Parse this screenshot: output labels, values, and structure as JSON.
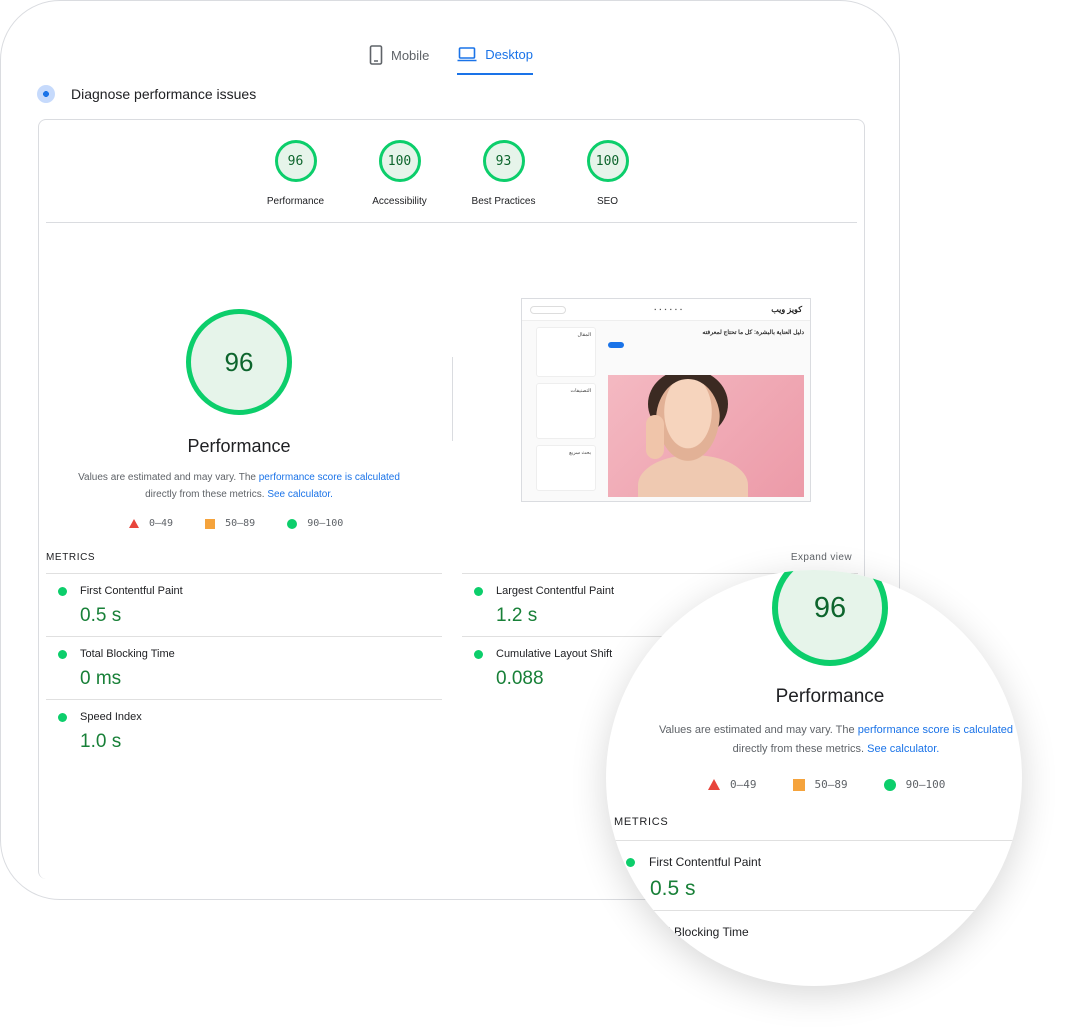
{
  "tabs": {
    "mobile": "Mobile",
    "desktop": "Desktop"
  },
  "diagnose_title": "Diagnose performance issues",
  "categories": [
    {
      "score": "96",
      "label": "Performance"
    },
    {
      "score": "100",
      "label": "Accessibility"
    },
    {
      "score": "93",
      "label": "Best Practices"
    },
    {
      "score": "100",
      "label": "SEO"
    }
  ],
  "performance": {
    "score": "96",
    "title": "Performance",
    "note_prefix": "Values are estimated and may vary. The ",
    "note_link1": "performance score is calculated",
    "note_middle": "directly from these metrics. ",
    "note_link2": "See calculator."
  },
  "legend": {
    "fail": "0–49",
    "average": "50–89",
    "pass": "90–100"
  },
  "metrics_title": "METRICS",
  "expand_view": "Expand view",
  "metrics": {
    "fcp": {
      "name": "First Contentful Paint",
      "value": "0.5 s"
    },
    "lcp": {
      "name": "Largest Contentful Paint",
      "value": "1.2 s"
    },
    "tbt": {
      "name": "Total Blocking Time",
      "value": "0 ms"
    },
    "cls": {
      "name": "Cumulative Layout Shift",
      "value": "0.088"
    },
    "si": {
      "name": "Speed Index",
      "value": "1.0 s"
    }
  },
  "thumbnail": {
    "brand": "كويز ويب",
    "headline": "دليل العناية بالبشرة: كل ما تحتاج لمعرفته",
    "side_label_1": "المقال",
    "side_label_2": "التصنيفات",
    "side_label_3": "بحث سريع"
  },
  "zoom": {
    "partial_metric": "l Blocking Time"
  },
  "colors": {
    "pass": "#0cce6b",
    "average": "#f5a33c",
    "fail": "#e8453c",
    "link": "#1a73e8",
    "value": "#188038"
  }
}
